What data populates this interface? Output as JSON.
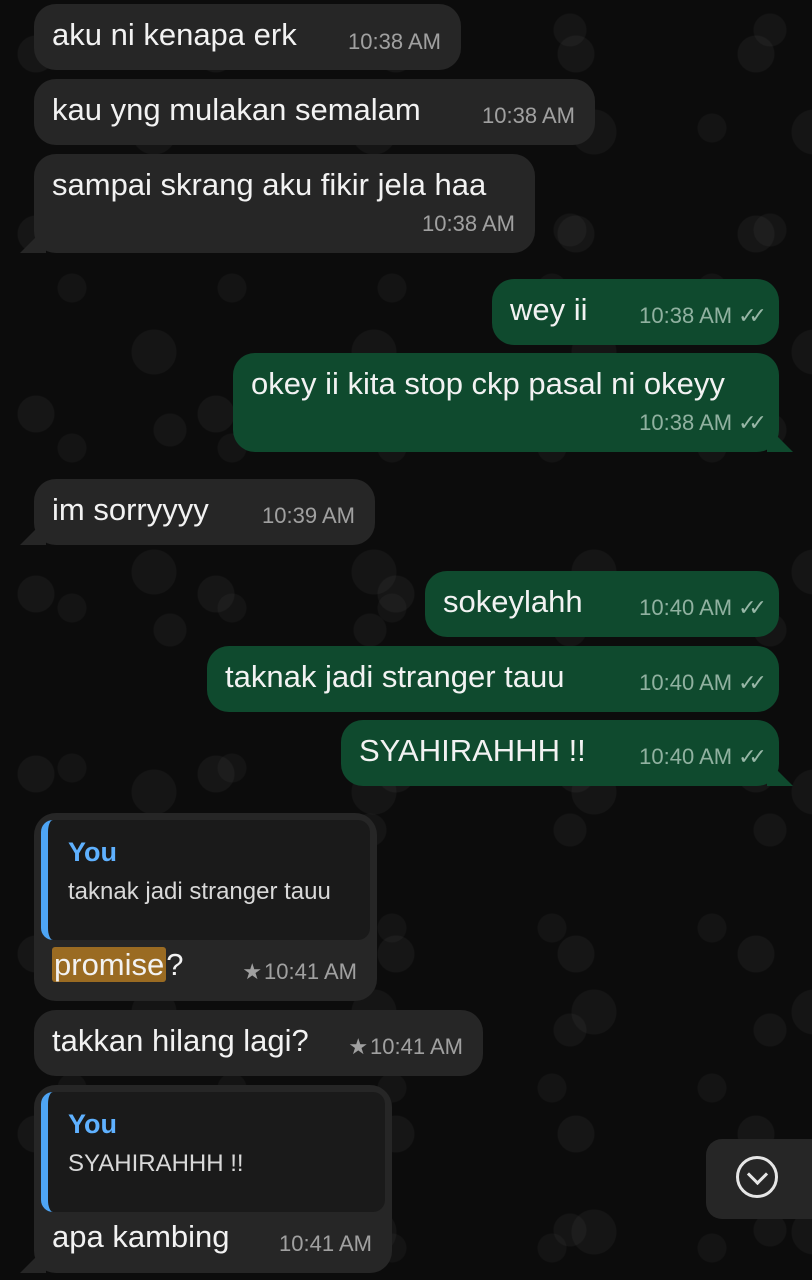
{
  "messages": [
    {
      "id": 1,
      "dir": "in",
      "text": "aku ni kenapa erk",
      "time": "10:38 AM"
    },
    {
      "id": 2,
      "dir": "in",
      "text": "kau yng mulakan semalam",
      "time": "10:38 AM"
    },
    {
      "id": 3,
      "dir": "in",
      "text": "sampai skrang aku fikir jela haa",
      "time": "10:38 AM"
    },
    {
      "id": 4,
      "dir": "out",
      "text": "wey ii",
      "time": "10:38 AM",
      "status": "read"
    },
    {
      "id": 5,
      "dir": "out",
      "text": "okey ii kita stop ckp pasal ni okeyy",
      "time": "10:38 AM",
      "status": "read"
    },
    {
      "id": 6,
      "dir": "in",
      "text": "im sorryyyy",
      "time": "10:39 AM"
    },
    {
      "id": 7,
      "dir": "out",
      "text": "sokeylahh",
      "time": "10:40 AM",
      "status": "read"
    },
    {
      "id": 8,
      "dir": "out",
      "text": "taknak jadi stranger tauu",
      "time": "10:40 AM",
      "status": "read"
    },
    {
      "id": 9,
      "dir": "out",
      "text": "SYAHIRAHHH !!",
      "time": "10:40 AM",
      "status": "read"
    },
    {
      "id": 10,
      "dir": "in",
      "reply_author": "You",
      "reply_text": "taknak jadi stranger tauu",
      "text_highlight": "promise",
      "text_rest": "?",
      "time": "10:41 AM",
      "starred": true
    },
    {
      "id": 11,
      "dir": "in",
      "text": "takkan hilang lagi?",
      "time": "10:41 AM",
      "starred": true
    },
    {
      "id": 12,
      "dir": "in",
      "reply_author": "You",
      "reply_text": "SYAHIRAHHH !!",
      "text": "apa kambing",
      "time": "10:41 AM"
    }
  ],
  "icons": {
    "read_ticks": "double-check-icon",
    "star": "star-icon",
    "scroll_down": "chevron-down-circle-icon"
  },
  "colors": {
    "incoming_bubble": "#262626",
    "outgoing_bubble": "#0f4a2e",
    "reply_accent": "#4ea5f5",
    "search_highlight": "#9a6b22"
  }
}
